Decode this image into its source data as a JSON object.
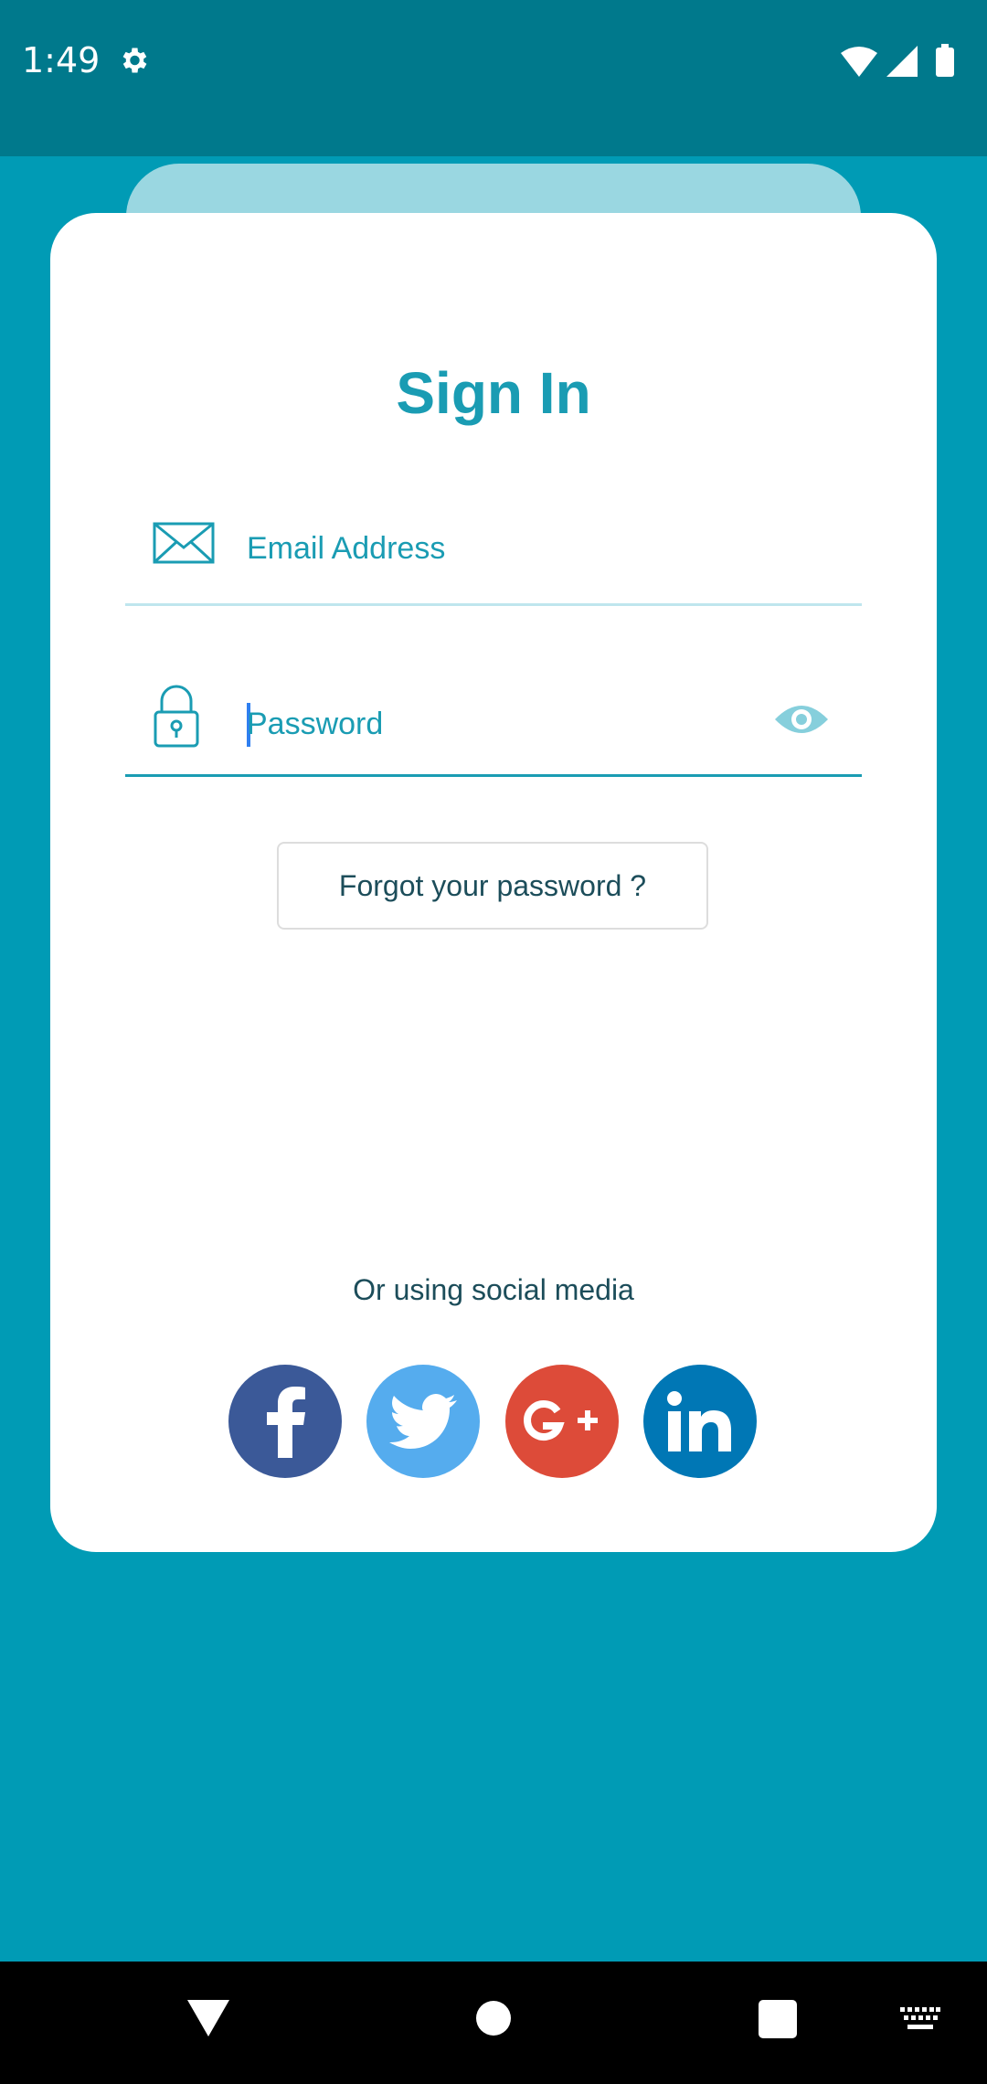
{
  "status_bar": {
    "time": "1:49",
    "icons": [
      "gear-icon",
      "wifi-icon",
      "cellular-signal-icon",
      "battery-icon"
    ],
    "color": "#00798c"
  },
  "sign_in": {
    "title": "Sign In",
    "email": {
      "placeholder": "Email Address",
      "icon": "envelope-icon"
    },
    "password": {
      "placeholder": "Password",
      "icon": "lock-icon",
      "toggle_icon": "eye-icon"
    },
    "forgot_label": "Forgot your password ?",
    "social_caption": "Or using social media",
    "social": [
      {
        "name": "facebook",
        "color": "#3b5998"
      },
      {
        "name": "twitter",
        "color": "#55acee"
      },
      {
        "name": "google-plus",
        "color": "#dd4b39"
      },
      {
        "name": "linkedin",
        "color": "#0077b5"
      }
    ]
  },
  "colors": {
    "background": "#009bb5",
    "accent": "#1a9cb3",
    "text_dark": "#1c4d5a"
  },
  "nav_bar": {
    "items": [
      "back-icon",
      "home-icon",
      "recents-icon",
      "keyboard-icon"
    ]
  }
}
